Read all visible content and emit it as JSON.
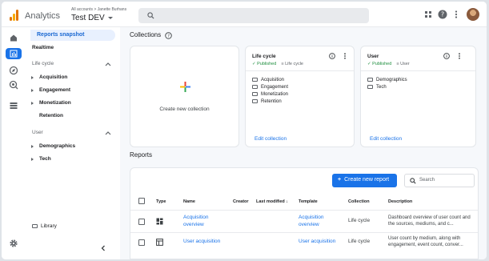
{
  "header": {
    "app_name": "Analytics",
    "breadcrumb": "All accounts > Janette Burhans",
    "property": "Test DEV",
    "search_placeholder": ""
  },
  "sidebar": {
    "active_item": "Reports snapshot",
    "realtime": "Realtime",
    "groups": [
      {
        "label": "Life cycle",
        "items": [
          "Acquisition",
          "Engagement",
          "Monetization",
          "Retention"
        ]
      },
      {
        "label": "User",
        "items": [
          "Demographics",
          "Tech"
        ]
      }
    ],
    "library": "Library"
  },
  "collections": {
    "title": "Collections",
    "create_label": "Create new collection",
    "cards": [
      {
        "title": "Life cycle",
        "status": "Published",
        "template": "Life cycle",
        "items": [
          "Acquisition",
          "Engagement",
          "Monetization",
          "Retention"
        ],
        "edit": "Edit collection"
      },
      {
        "title": "User",
        "status": "Published",
        "template": "User",
        "items": [
          "Demographics",
          "Tech"
        ],
        "edit": "Edit collection"
      }
    ]
  },
  "reports": {
    "title": "Reports",
    "new_button": "Create new report",
    "search_placeholder": "Search",
    "columns": [
      "Type",
      "Name",
      "Creator",
      "Last modified",
      "Template",
      "Collection",
      "Description"
    ],
    "rows": [
      {
        "name": "Acquisition overview",
        "creator": "",
        "template": "Acquisition overview",
        "collection": "Life cycle",
        "description": "Dashboard overview of user count and the sources, mediums, and c..."
      },
      {
        "name": "User acquisition",
        "creator": "",
        "template": "User acquisition",
        "collection": "Life cycle",
        "description": "User count by medium, along with engagement, event count, conver..."
      }
    ]
  },
  "colors": {
    "accent": "#1a73e8",
    "published": "#1e8e3e",
    "active_bg": "#e8f0fe"
  }
}
